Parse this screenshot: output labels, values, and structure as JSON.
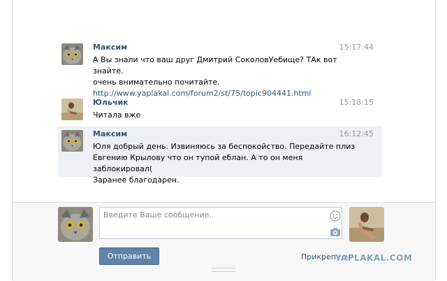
{
  "messages": [
    {
      "name": "Максим",
      "time": "15:17:44",
      "lines": [
        "А Вы знали что ваш друг Дмитрий СоколовУебище? ТАк вот знайте.",
        "очень внимательно почитайте."
      ],
      "link": "http://www.yaplakal.com/forum2/st/75/topic904441.html"
    },
    {
      "name": "Юльчик",
      "time": "15:18:15",
      "lines": [
        "Читала вже"
      ]
    },
    {
      "name": "Максим",
      "time": "16:12:45",
      "lines": [
        "Юля добрый день. Извиняюсь за беспокойство. Передайте плиз",
        "Евгению Крылову что он тупой еблан. А то он меня заблокировал(",
        "Заранее благодарен."
      ]
    }
  ],
  "composer": {
    "placeholder": "Введите Ваше сообщение..",
    "send_label": "Отправить",
    "attach_label": "Прикрепить"
  },
  "watermark": "YAPLAKAL.COM",
  "colors": {
    "name": "#2b587a",
    "highlight": "#edf1f5",
    "button": "#5e82a8"
  }
}
